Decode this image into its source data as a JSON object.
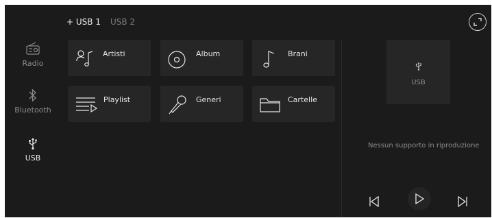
{
  "source_tabs": [
    {
      "label": "+ USB 1",
      "active": true
    },
    {
      "label": "USB 2",
      "active": false
    }
  ],
  "sidebar": {
    "items": [
      {
        "label": "Radio",
        "icon": "radio-icon",
        "active": false
      },
      {
        "label": "Bluetooth",
        "icon": "bluetooth-icon",
        "active": false
      },
      {
        "label": "USB",
        "icon": "usb-icon",
        "active": true
      }
    ]
  },
  "categories": [
    {
      "label": "Artisti",
      "icon": "artist-icon"
    },
    {
      "label": "Album",
      "icon": "album-icon"
    },
    {
      "label": "Brani",
      "icon": "music-note-icon"
    },
    {
      "label": "Playlist",
      "icon": "playlist-icon"
    },
    {
      "label": "Generi",
      "icon": "microphone-icon"
    },
    {
      "label": "Cartelle",
      "icon": "folder-icon"
    }
  ],
  "now_playing": {
    "source_label": "USB",
    "status": "Nessun supporto in riproduzione"
  },
  "controls": {
    "previous": "skip-previous-icon",
    "play": "play-icon",
    "next": "skip-next-icon",
    "expand": "expand-icon"
  },
  "colors": {
    "background": "#1b1b1b",
    "tile": "#262626",
    "text_primary": "#e6e6e6",
    "text_muted": "#8a8a8a"
  }
}
